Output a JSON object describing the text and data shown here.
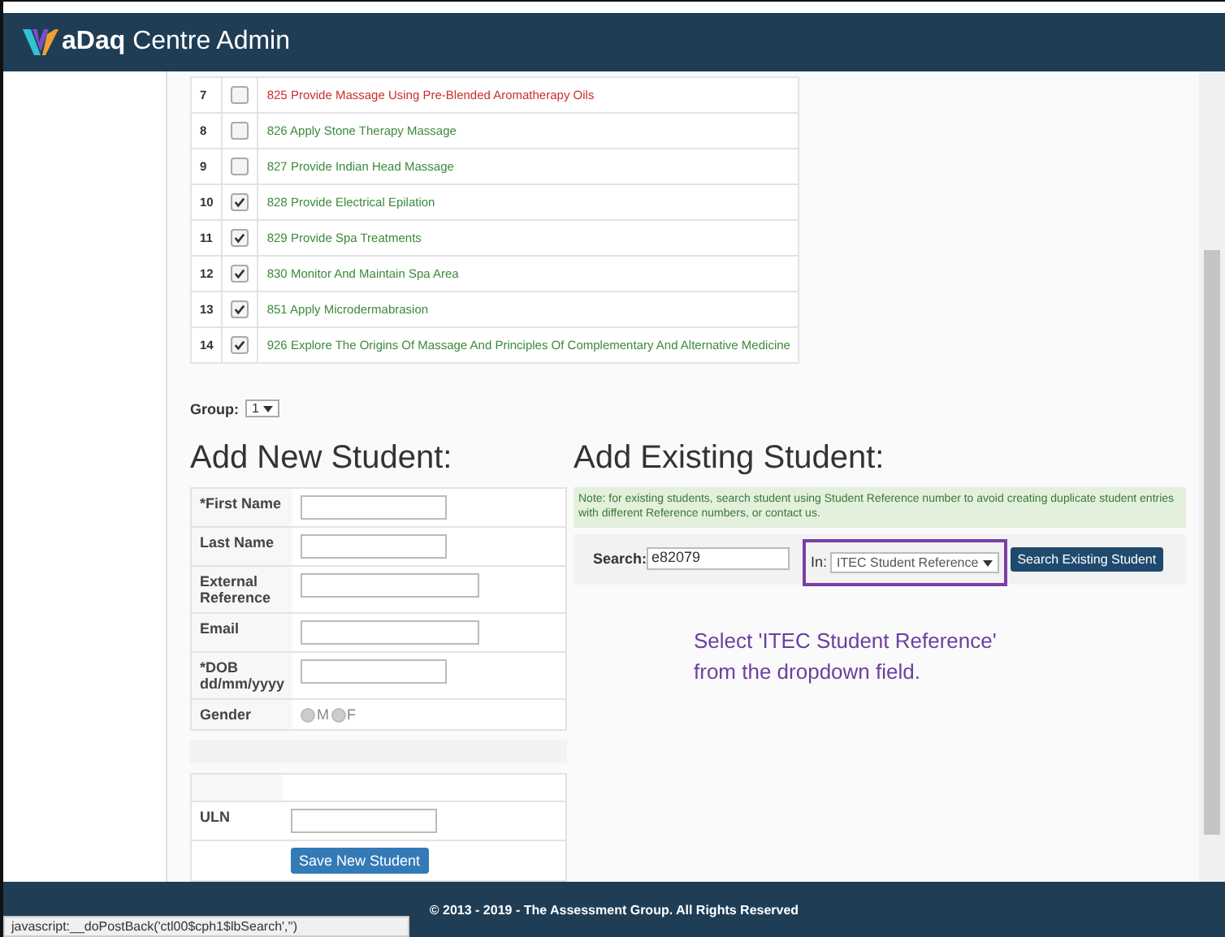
{
  "header": {
    "title": "**aDaq** Centre Admin"
  },
  "units": [
    {
      "number": "7",
      "checked": false,
      "name": "825 Provide Massage Using Pre-Blended Aromatherapy Oils",
      "color": "#c9302c"
    },
    {
      "number": "8",
      "checked": false,
      "name": "826 Apply Stone Therapy Massage",
      "color": "#3c8a3c"
    },
    {
      "number": "9",
      "checked": false,
      "name": "827 Provide Indian Head Massage",
      "color": "#3c8a3c"
    },
    {
      "number": "10",
      "checked": true,
      "name": "828 Provide Electrical Epilation",
      "color": "#3c8a3c"
    },
    {
      "number": "11",
      "checked": true,
      "name": "829 Provide Spa Treatments",
      "color": "#3c8a3c"
    },
    {
      "number": "12",
      "checked": true,
      "name": "830 Monitor And Maintain Spa Area",
      "color": "#3c8a3c"
    },
    {
      "number": "13",
      "checked": true,
      "name": "851 Apply Microdermabrasion",
      "color": "#3c8a3c"
    },
    {
      "number": "14",
      "checked": true,
      "name": "926 Explore The Origins Of Massage And Principles Of Complementary And Alternative Medicine",
      "color": "#3c8a3c"
    }
  ],
  "group": {
    "label": "Group:",
    "value": "1"
  },
  "new_student": {
    "heading": "Add New Student:",
    "fields": [
      {
        "kind": "text",
        "label": "*First Name",
        "wide": false
      },
      {
        "kind": "text",
        "label": "Last Name",
        "wide": false
      },
      {
        "kind": "text",
        "label": "External Reference",
        "wide": true
      },
      {
        "kind": "text",
        "label": "Email",
        "wide": true
      },
      {
        "kind": "text",
        "label": "*DOB dd/mm/yyyy",
        "wide": false
      },
      {
        "kind": "radio",
        "label": "Gender",
        "options": [
          {
            "label": "M",
            "selected": false
          },
          {
            "label": "F",
            "selected": false
          }
        ]
      }
    ],
    "uln": {
      "label": "ULN"
    },
    "save_button": "Save New Student"
  },
  "existing_student": {
    "heading": "Add Existing Student:",
    "note": "Note: for existing students, search student using Student Reference number to avoid creating duplicate student entries with different Reference numbers, or contact us.",
    "search_label": "Search:",
    "search_value": "e82079",
    "in_label": "In:",
    "in_value": "ITEC Student Reference",
    "button": "Search Existing Student"
  },
  "annotation": "Select 'ITEC Student Reference' from the dropdown field.",
  "footer": "© 2013 - 2019 - The Assessment Group. All Rights Reserved",
  "status_url": "javascript:__doPostBack('ctl00$cph1$lbSearch','')"
}
